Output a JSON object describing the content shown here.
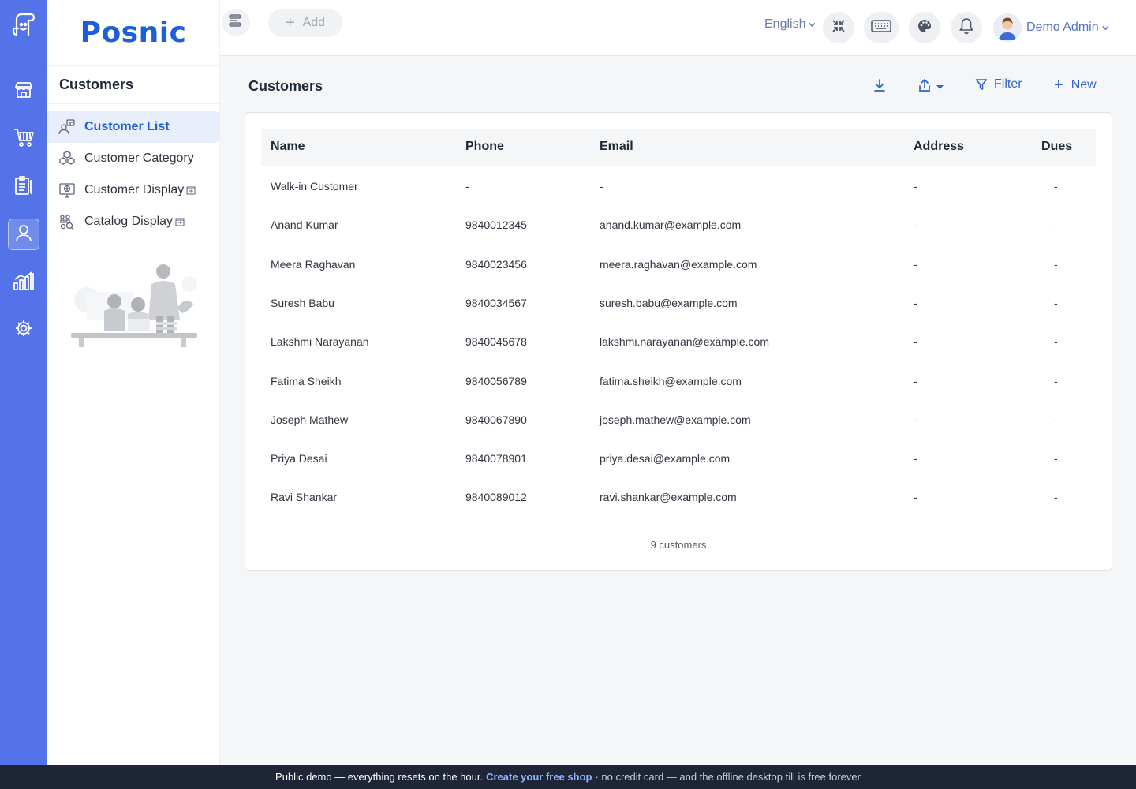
{
  "brand": {
    "name": "Posnic"
  },
  "rail": {
    "items": [
      {
        "name": "store",
        "icon": "store-icon"
      },
      {
        "name": "cart",
        "icon": "cart-icon"
      },
      {
        "name": "clipboard",
        "icon": "clipboard-icon"
      },
      {
        "name": "customers",
        "icon": "user-icon",
        "active": true
      },
      {
        "name": "reports",
        "icon": "chart-icon"
      },
      {
        "name": "settings",
        "icon": "gear-icon"
      }
    ]
  },
  "sidebar": {
    "title": "Customers",
    "items": [
      {
        "label": "Customer List",
        "icon": "customer-list-icon",
        "active": true
      },
      {
        "label": "Customer Category",
        "icon": "category-icon"
      },
      {
        "label": "Customer Display",
        "icon": "display-icon",
        "external": true
      },
      {
        "label": "Catalog Display",
        "icon": "catalog-icon",
        "external": true
      }
    ]
  },
  "topbar": {
    "add_label": "Add",
    "language": "English",
    "user_name": "Demo Admin"
  },
  "page": {
    "title": "Customers",
    "filter_label": "Filter",
    "new_label": "New"
  },
  "table": {
    "columns": [
      "Name",
      "Phone",
      "Email",
      "Address",
      "Dues"
    ],
    "rows": [
      [
        "Walk-in Customer",
        "-",
        "-",
        "-",
        "-"
      ],
      [
        "Anand Kumar",
        "9840012345",
        "anand.kumar@example.com",
        "-",
        "-"
      ],
      [
        "Meera Raghavan",
        "9840023456",
        "meera.raghavan@example.com",
        "-",
        "-"
      ],
      [
        "Suresh Babu",
        "9840034567",
        "suresh.babu@example.com",
        "-",
        "-"
      ],
      [
        "Lakshmi Narayanan",
        "9840045678",
        "lakshmi.narayanan@example.com",
        "-",
        "-"
      ],
      [
        "Fatima Sheikh",
        "9840056789",
        "fatima.sheikh@example.com",
        "-",
        "-"
      ],
      [
        "Joseph Mathew",
        "9840067890",
        "joseph.mathew@example.com",
        "-",
        "-"
      ],
      [
        "Priya Desai",
        "9840078901",
        "priya.desai@example.com",
        "-",
        "-"
      ],
      [
        "Ravi Shankar",
        "9840089012",
        "ravi.shankar@example.com",
        "-",
        "-"
      ]
    ],
    "footer": "9 customers"
  },
  "banner": {
    "lead": "Public demo — everything resets on the hour.",
    "link": "Create your free shop",
    "tail": "· no credit card — and the offline desktop till is free forever"
  },
  "colors": {
    "rail": "#5473e8",
    "brand": "#1d5fd9",
    "accent": "#2f64c8",
    "banner": "#1e2537"
  }
}
